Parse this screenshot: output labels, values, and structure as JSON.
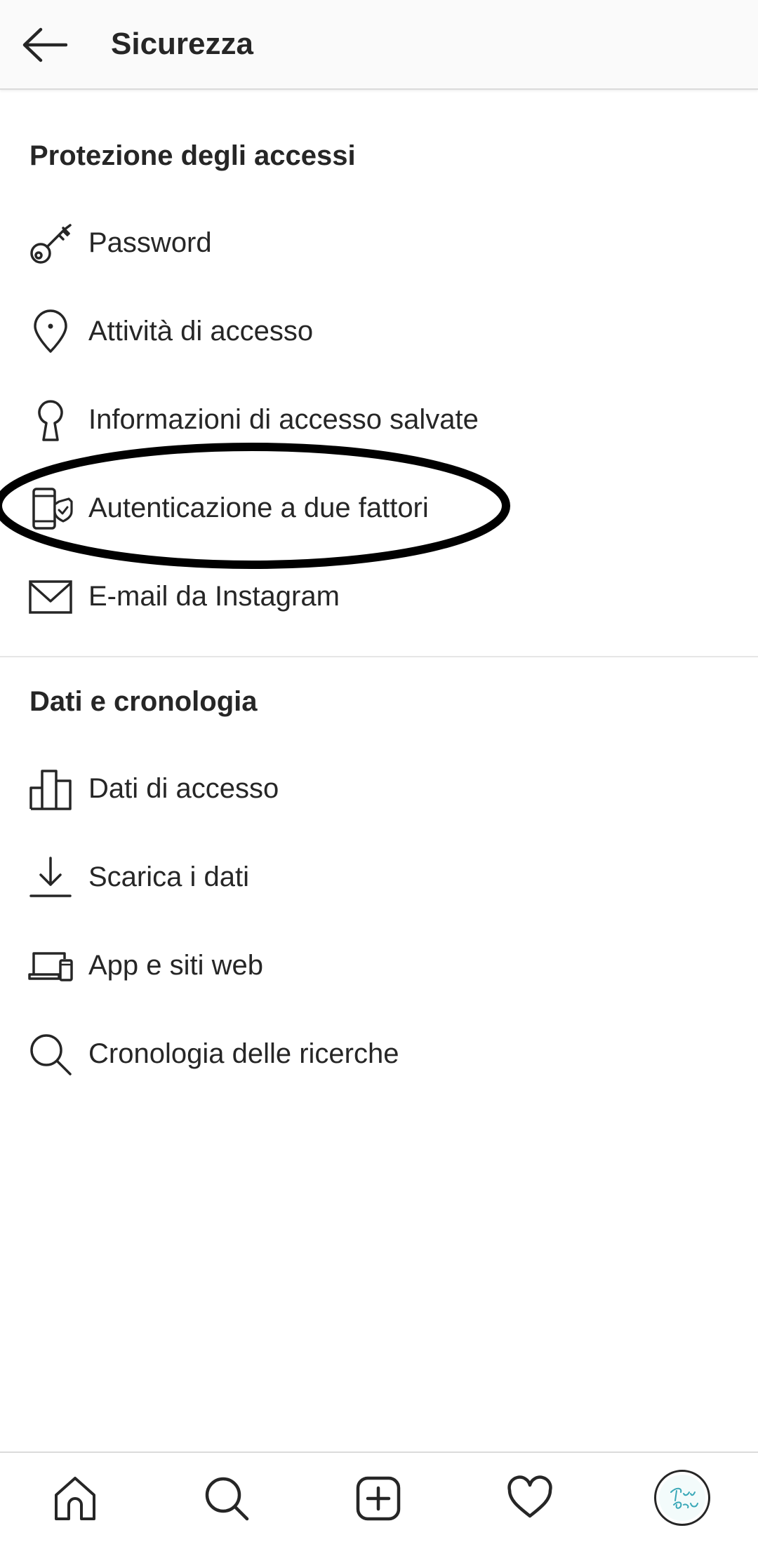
{
  "header": {
    "title": "Sicurezza",
    "back_icon": "arrow-left-icon"
  },
  "sections": [
    {
      "title": "Protezione degli accessi",
      "items": [
        {
          "label": "Password",
          "icon": "key-icon"
        },
        {
          "label": "Attività di accesso",
          "icon": "location-pin-icon"
        },
        {
          "label": "Informazioni di accesso salvate",
          "icon": "keyhole-icon"
        },
        {
          "label": "Autenticazione a due fattori",
          "icon": "phone-shield-icon",
          "highlighted": true
        },
        {
          "label": "E-mail da Instagram",
          "icon": "envelope-icon"
        }
      ]
    },
    {
      "title": "Dati e cronologia",
      "items": [
        {
          "label": "Dati di accesso",
          "icon": "bar-chart-icon"
        },
        {
          "label": "Scarica i dati",
          "icon": "download-icon"
        },
        {
          "label": "App e siti web",
          "icon": "laptop-phone-icon"
        },
        {
          "label": "Cronologia delle ricerche",
          "icon": "search-icon"
        }
      ]
    }
  ],
  "bottom_nav": {
    "items": [
      "home-icon",
      "search-icon",
      "plus-square-icon",
      "heart-icon",
      "profile-avatar"
    ]
  },
  "colors": {
    "text": "#262626",
    "header_bg": "#fafafa",
    "divider": "#dbdbdb",
    "annotation": "#000000"
  }
}
